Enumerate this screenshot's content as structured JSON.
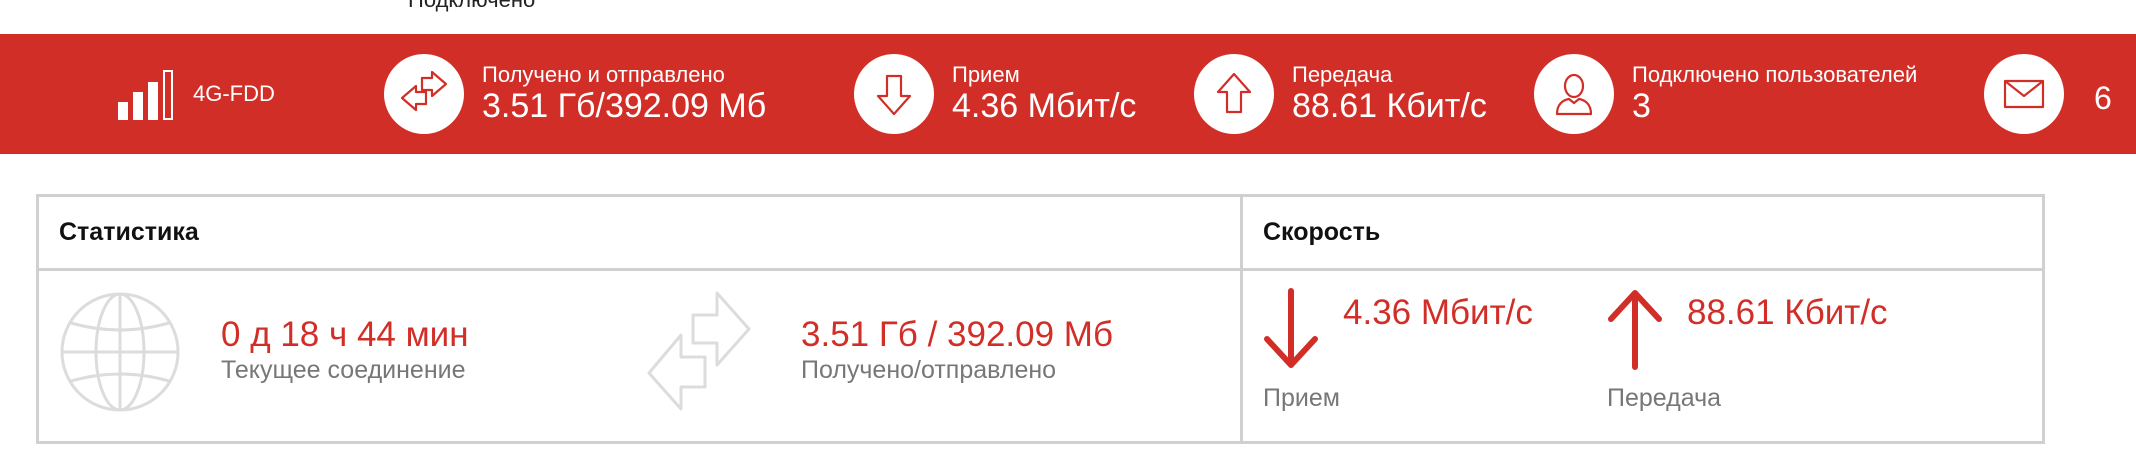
{
  "header": {
    "connection_status": "Подключено"
  },
  "statusbar": {
    "network_type": "4G-FDD",
    "signal_bars": 4,
    "received_sent_label": "Получено и отправлено",
    "received_sent_value": "3.51 Гб/392.09 Мб",
    "download_label": "Прием",
    "download_value": "4.36 Мбит/с",
    "upload_label": "Передача",
    "upload_value": "88.61 Кбит/с",
    "users_label": "Подключено пользователей",
    "users_value": "3",
    "messages_count": "6"
  },
  "statistics": {
    "title": "Статистика",
    "uptime_value": "0 д 18 ч 44 мин",
    "uptime_label": "Текущее соединение",
    "traffic_value": "3.51 Гб / 392.09 Мб",
    "traffic_label": "Получено/отправлено"
  },
  "speed": {
    "title": "Скорость",
    "download_value": "4.36 Мбит/с",
    "download_label": "Прием",
    "upload_value": "88.61 Кбит/с",
    "upload_label": "Передача"
  },
  "colors": {
    "accent": "#d22e28",
    "border": "#d0d0d0",
    "muted": "#777777"
  }
}
